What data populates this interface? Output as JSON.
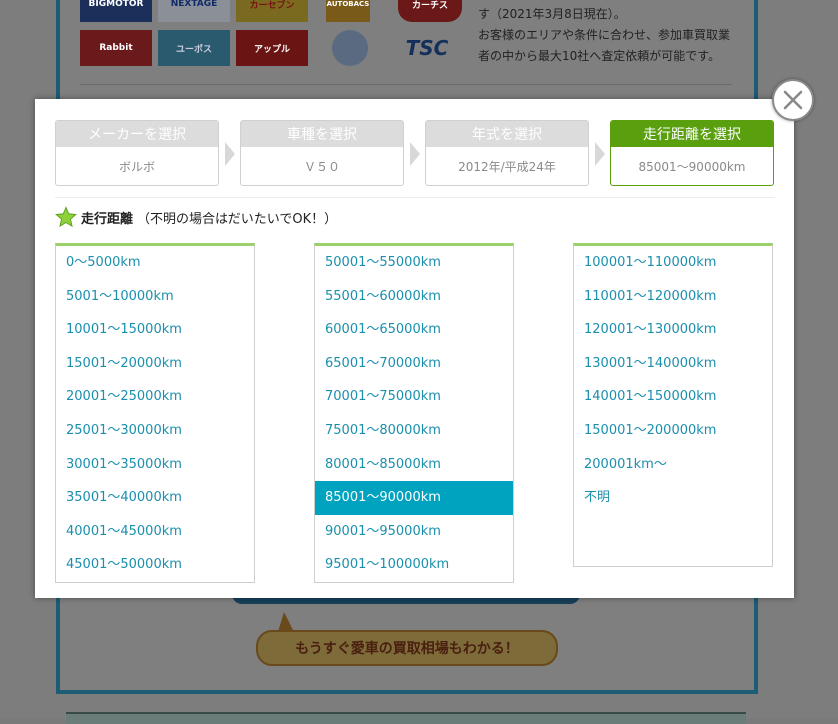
{
  "background": {
    "logos": [
      "BIGMOTOR",
      "NEXTAGE",
      "カーセブン",
      "AUTOBACS",
      "カーチス",
      "Rabbit",
      "ユーポス",
      "アップル",
      "",
      "TSC"
    ],
    "intro_text": [
      "す（2021年3月8日現在）。",
      "お客様のエリアや条件に合わせ、参加車買取業",
      "者の中から最大10社へ査定依頼が可能です。"
    ],
    "bubble_text": "もうすぐ愛車の買取相場もわかる！"
  },
  "steps": [
    {
      "label": "メーカーを選択",
      "value": "ボルボ",
      "active": false
    },
    {
      "label": "車種を選択",
      "value": "Ｖ５０",
      "active": false
    },
    {
      "label": "年式を選択",
      "value": "2012年/平成24年",
      "active": false
    },
    {
      "label": "走行距離を選択",
      "value": "85001～90000km",
      "active": true
    }
  ],
  "section": {
    "title": "走行距離",
    "note": "（不明の場合はだいたいでOK！）",
    "icon": "star-icon"
  },
  "columns": [
    [
      "0～5000km",
      "5001～10000km",
      "10001～15000km",
      "15001～20000km",
      "20001～25000km",
      "25001～30000km",
      "30001～35000km",
      "35001～40000km",
      "40001～45000km",
      "45001～50000km"
    ],
    [
      "50001～55000km",
      "55001～60000km",
      "60001～65000km",
      "65001～70000km",
      "70001～75000km",
      "75001～80000km",
      "80001～85000km",
      "85001～90000km",
      "90001～95000km",
      "95001～100000km"
    ],
    [
      "100001～110000km",
      "110001～120000km",
      "120001～130000km",
      "130001～140000km",
      "140001～150000km",
      "150001～200000km",
      "200001km～",
      "不明"
    ]
  ],
  "selected": "85001～90000km",
  "colors": {
    "accent_green": "#5aa00e",
    "link_teal": "#1a8fae",
    "selected_bg": "#00a3bf",
    "column_top": "#9bd06a"
  }
}
